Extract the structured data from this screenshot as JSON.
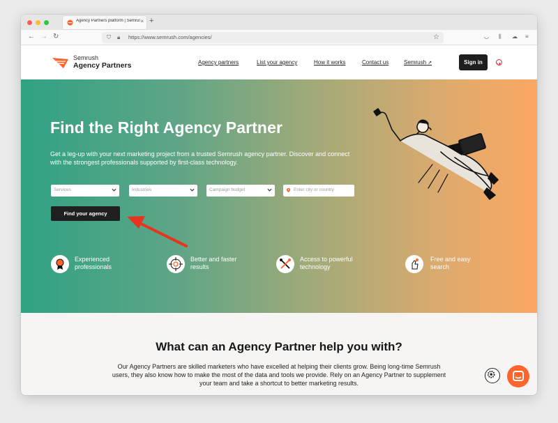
{
  "browser": {
    "tab_title": "Agency Partners platform | Semrush",
    "new_tab": "+",
    "url": "https://www.semrush.com/agencies/"
  },
  "site": {
    "logo_top": "Semrush",
    "logo_bottom": "Agency Partners",
    "menu": [
      "Agency partners",
      "List your agency",
      "How it works",
      "Contact us",
      "Semrush"
    ],
    "signin": "Sign in"
  },
  "hero": {
    "title": "Find the Right Agency Partner",
    "subtitle": "Get a leg-up with your next marketing project from a trusted Semrush agency partner. Discover and connect with the strongest professionals supported by first-class technology.",
    "filters": {
      "services": "Services",
      "industries": "Industries",
      "budget": "Campaign budget",
      "location": "Enter city or country"
    },
    "find_button": "Find your agency",
    "features": [
      {
        "text": "Experienced\nprofessionals",
        "icon": "medal-icon"
      },
      {
        "text": "Better and faster\nresults",
        "icon": "target-icon"
      },
      {
        "text": "Access to powerful\ntechnology",
        "icon": "tools-icon"
      },
      {
        "text": "Free and easy\nsearch",
        "icon": "hand-icon"
      }
    ]
  },
  "section": {
    "title": "What can an Agency Partner help you with?",
    "body": "Our Agency Partners are skilled marketers who have excelled at helping their clients grow. Being long-time Semrush users, they also know how to make the most of the data and tools we provide. Rely on an Agency Partner to supplement your team and take a shortcut to better marketing results."
  },
  "colors": {
    "accent": "#ff642d",
    "hero_start": "#30a283",
    "hero_end": "#fba861",
    "dark_button": "#1f1f1f",
    "annotation_arrow": "#e8331f"
  }
}
